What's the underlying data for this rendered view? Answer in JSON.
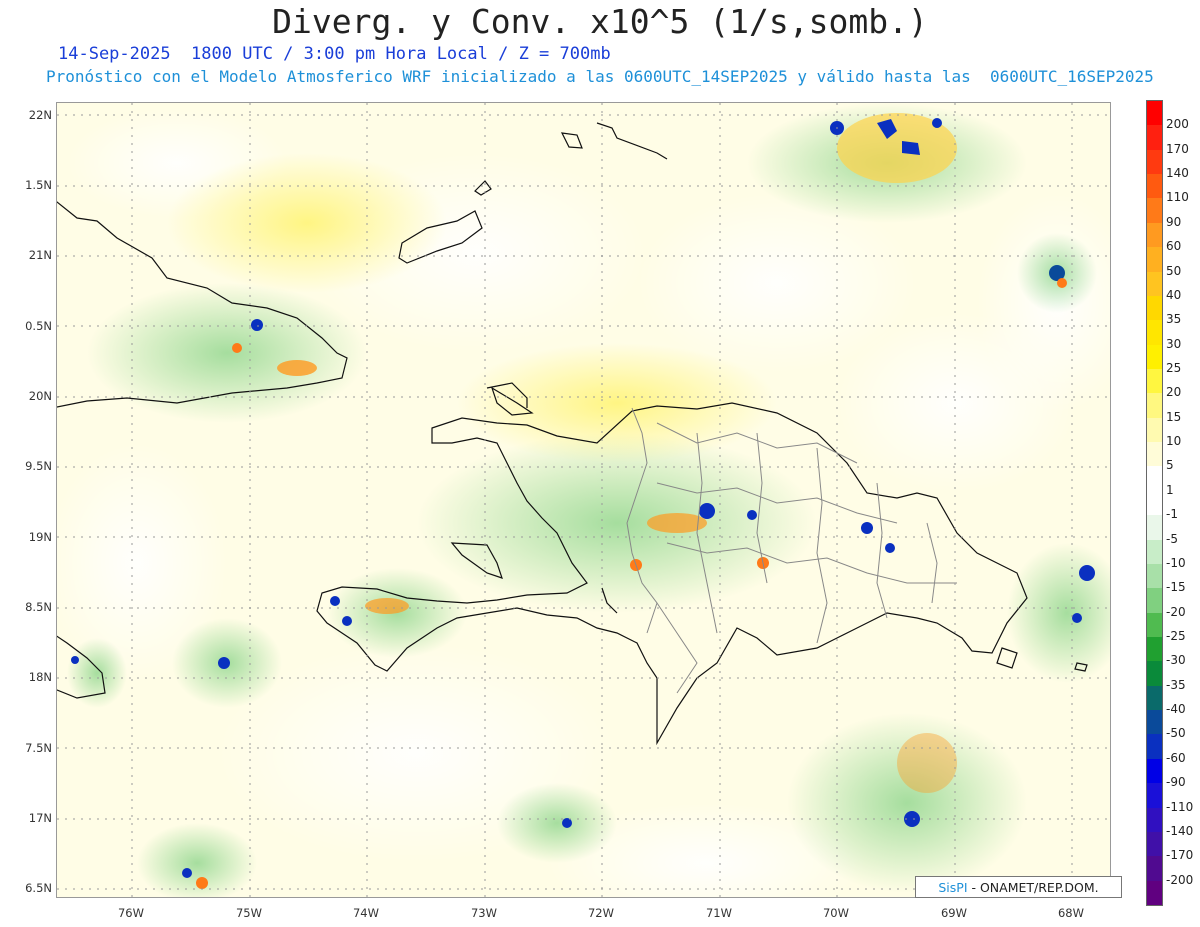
{
  "header": {
    "title": "Diverg. y Conv. x10^5 (1/s,somb.)",
    "subtitle_1": "14-Sep-2025  1800 UTC / 3:00 pm Hora Local / Z = 700mb",
    "subtitle_2": "Pronóstico con el Modelo Atmosferico WRF inicializado a las 0600UTC_14SEP2025 y válido hasta las  0600UTC_16SEP2025"
  },
  "axes": {
    "lat_labels": [
      "22N",
      "1.5N",
      "21N",
      "0.5N",
      "20N",
      "9.5N",
      "19N",
      "8.5N",
      "18N",
      "7.5N",
      "17N",
      "6.5N"
    ],
    "lon_labels": [
      "76W",
      "75W",
      "74W",
      "73W",
      "72W",
      "71W",
      "70W",
      "69W",
      "68W"
    ]
  },
  "colorbar": {
    "labels": [
      "200",
      "170",
      "140",
      "110",
      "90",
      "60",
      "50",
      "40",
      "35",
      "30",
      "25",
      "20",
      "15",
      "10",
      "5",
      "1",
      "-1",
      "-5",
      "-10",
      "-15",
      "-20",
      "-25",
      "-30",
      "-35",
      "-40",
      "-50",
      "-60",
      "-90",
      "-110",
      "-140",
      "-170",
      "-200"
    ],
    "colors": [
      "#ff0000",
      "#ff2010",
      "#ff3a10",
      "#ff5a10",
      "#ff7a18",
      "#ff9a20",
      "#ffb020",
      "#ffc420",
      "#ffd800",
      "#ffe600",
      "#fff000",
      "#fff640",
      "#fff880",
      "#fffab0",
      "#fffcd8",
      "#ffffff",
      "#ffffff",
      "#eaf7ea",
      "#c8edc8",
      "#a8e0a8",
      "#80d080",
      "#50bb50",
      "#20a030",
      "#0a8a3a",
      "#0a6a6a",
      "#0a4a9a",
      "#0a30c0",
      "#0000e6",
      "#1a10d8",
      "#3010c0",
      "#4010a8",
      "#500a90",
      "#600080"
    ]
  },
  "credit": {
    "brand": "SisPI",
    "text": " - ONAMET/REP.DOM."
  }
}
